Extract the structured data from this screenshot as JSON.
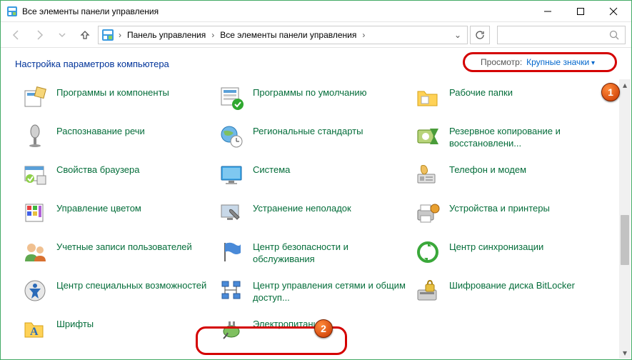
{
  "window": {
    "title": "Все элементы панели управления"
  },
  "nav": {
    "crumb1": "Панель управления",
    "crumb2": "Все элементы панели управления"
  },
  "heading": "Настройка параметров компьютера",
  "view": {
    "label": "Просмотр:",
    "value": "Крупные значки"
  },
  "badges": {
    "one": "1",
    "two": "2"
  },
  "items": {
    "r1c1": "Программы и компоненты",
    "r1c2": "Программы по умолчанию",
    "r1c3": "Рабочие папки",
    "r2c1": "Распознавание речи",
    "r2c2": "Региональные стандарты",
    "r2c3": "Резервное копирование и восстановлени...",
    "r3c1": "Свойства браузера",
    "r3c2": "Система",
    "r3c3": "Телефон и модем",
    "r4c1": "Управление цветом",
    "r4c2": "Устранение неполадок",
    "r4c3": "Устройства и принтеры",
    "r5c1": "Учетные записи пользователей",
    "r5c2": "Центр безопасности и обслуживания",
    "r5c3": "Центр синхронизации",
    "r6c1": "Центр специальных возможностей",
    "r6c2": "Центр управления сетями и общим доступ...",
    "r6c3": "Шифрование диска BitLocker",
    "r7c1": "Шрифты",
    "r7c2": "Электропитание"
  }
}
